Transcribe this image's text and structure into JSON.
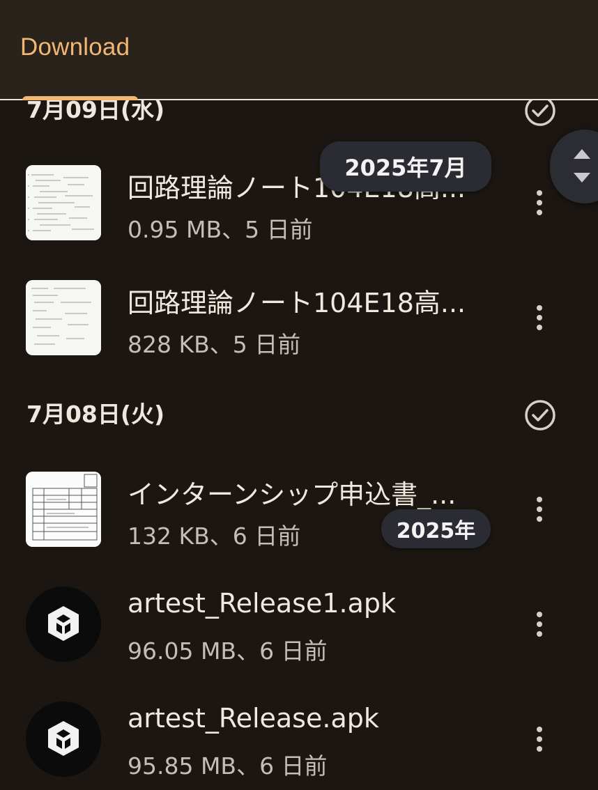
{
  "tab": {
    "label": "Download"
  },
  "sections": [
    {
      "date": "7月09日(水)"
    },
    {
      "date": "7月08日(火)"
    }
  ],
  "files": [
    {
      "title": "回路理論ノート104E18高...",
      "meta": "0.95 MB、5 日前",
      "thumb": "document"
    },
    {
      "title": "回路理論ノート104E18高...",
      "meta": "828 KB、5 日前",
      "thumb": "document"
    },
    {
      "title": "インターンシップ申込書_...",
      "meta": "132 KB、6 日前",
      "thumb": "form"
    },
    {
      "title": "artest_Release1.apk",
      "meta": "96.05 MB、6 日前",
      "thumb": "unity-icon"
    },
    {
      "title": "artest_Release.apk",
      "meta": "95.85 MB、6 日前",
      "thumb": "unity-icon"
    }
  ],
  "tooltips": {
    "month": "2025年7月",
    "year": "2025年"
  },
  "colors": {
    "accent": "#f2b773",
    "background": "#1b1611",
    "topbar": "#2a231c"
  }
}
